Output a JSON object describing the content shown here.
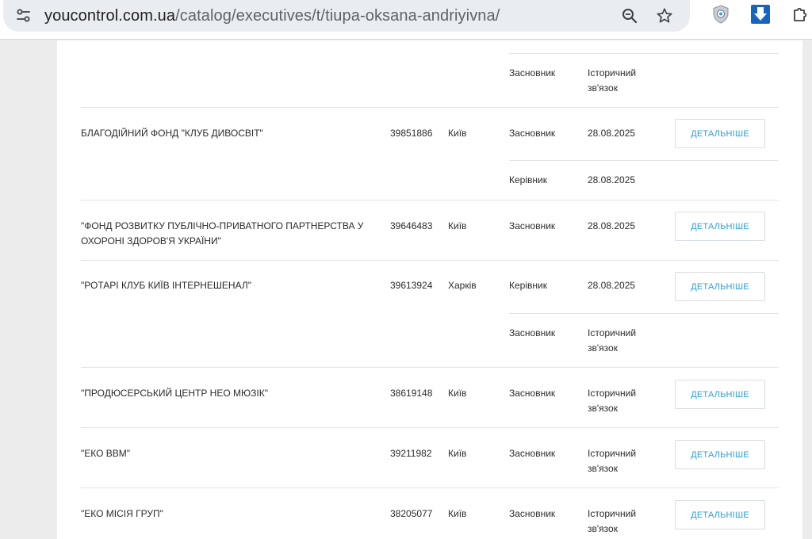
{
  "browser": {
    "url_host": "youcontrol.com.ua",
    "url_path": "/catalog/executives/t/tiupa-oksana-andriyivna/"
  },
  "table": {
    "details_label": "ДЕТАЛЬНІШЕ",
    "rows": [
      {
        "name": "",
        "code": "",
        "city": "",
        "roles": [
          {
            "role": "Засновник",
            "date": "Історичний зв'язок"
          }
        ]
      },
      {
        "name": "БЛАГОДІЙНИЙ ФОНД \"КЛУБ ДИВОСВІТ\"",
        "code": "39851886",
        "city": "Київ",
        "roles": [
          {
            "role": "Засновник",
            "date": "28.08.2025"
          },
          {
            "role": "Керівник",
            "date": "28.08.2025"
          }
        ]
      },
      {
        "name": "\"ФОНД РОЗВИТКУ ПУБЛІЧНО-ПРИВАТНОГО ПАРТНЕРСТВА У ОХОРОНІ ЗДОРОВ'Я УКРАЇНИ\"",
        "code": "39646483",
        "city": "Київ",
        "roles": [
          {
            "role": "Засновник",
            "date": "28.08.2025"
          }
        ]
      },
      {
        "name": "\"РОТАРІ КЛУБ КИЇВ ІНТЕРНЕШЕНАЛ\"",
        "code": "39613924",
        "city": "Харків",
        "roles": [
          {
            "role": "Керівник",
            "date": "28.08.2025"
          },
          {
            "role": "Засновник",
            "date": "Історичний зв'язок"
          }
        ]
      },
      {
        "name": "\"ПРОДЮСЕРСЬКИЙ ЦЕНТР НЕО МЮЗІК\"",
        "code": "38619148",
        "city": "Київ",
        "roles": [
          {
            "role": "Засновник",
            "date": "Історичний зв'язок"
          }
        ]
      },
      {
        "name": "\"ЕКО ВВМ\"",
        "code": "39211982",
        "city": "Київ",
        "roles": [
          {
            "role": "Засновник",
            "date": "Історичний зв'язок"
          }
        ]
      },
      {
        "name": "\"ЕКО МІСІЯ ГРУП\"",
        "code": "38205077",
        "city": "Київ",
        "roles": [
          {
            "role": "Засновник",
            "date": "Історичний зв'язок"
          }
        ]
      }
    ]
  },
  "icons": {
    "site_info": "tune-icon",
    "zoom": "zoom-out-icon",
    "bookmark": "star-icon",
    "ext1": "shield-extension-icon",
    "ext2": "download-extension-icon",
    "ext3": "puzzle-extension-icon"
  }
}
